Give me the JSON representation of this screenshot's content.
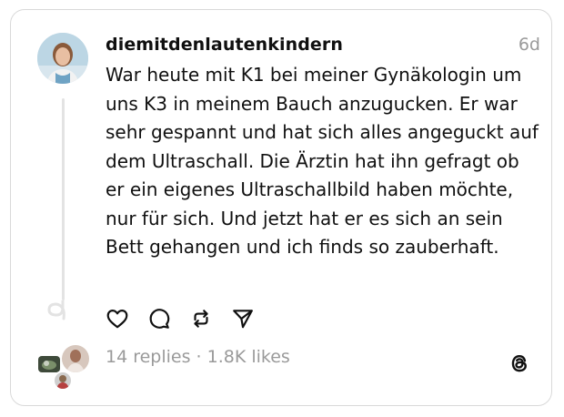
{
  "post": {
    "username": "diemitdenlautenkindern",
    "time": "6d",
    "text": "War heute mit K1 bei meiner Gynäkologin um uns K3 in meinem Bauch anzugucken. Er war sehr gespannt und hat sich alles angeguckt auf dem Ultraschall. Die Ärztin hat ihn gefragt ob er ein eigenes Ultraschallbild haben möchte, nur für sich. Und jetzt hat er es sich an sein Bett gehangen und ich finds so zauberhaft."
  },
  "actions": {
    "like_icon": "heart-icon",
    "reply_icon": "comment-icon",
    "repost_icon": "repost-icon",
    "share_icon": "send-icon"
  },
  "stats": {
    "replies": "14 replies",
    "separator": " · ",
    "likes": "1.8K likes"
  },
  "colors": {
    "text": "#101010",
    "muted": "#9a9a9a",
    "border": "#d9d9d9"
  }
}
